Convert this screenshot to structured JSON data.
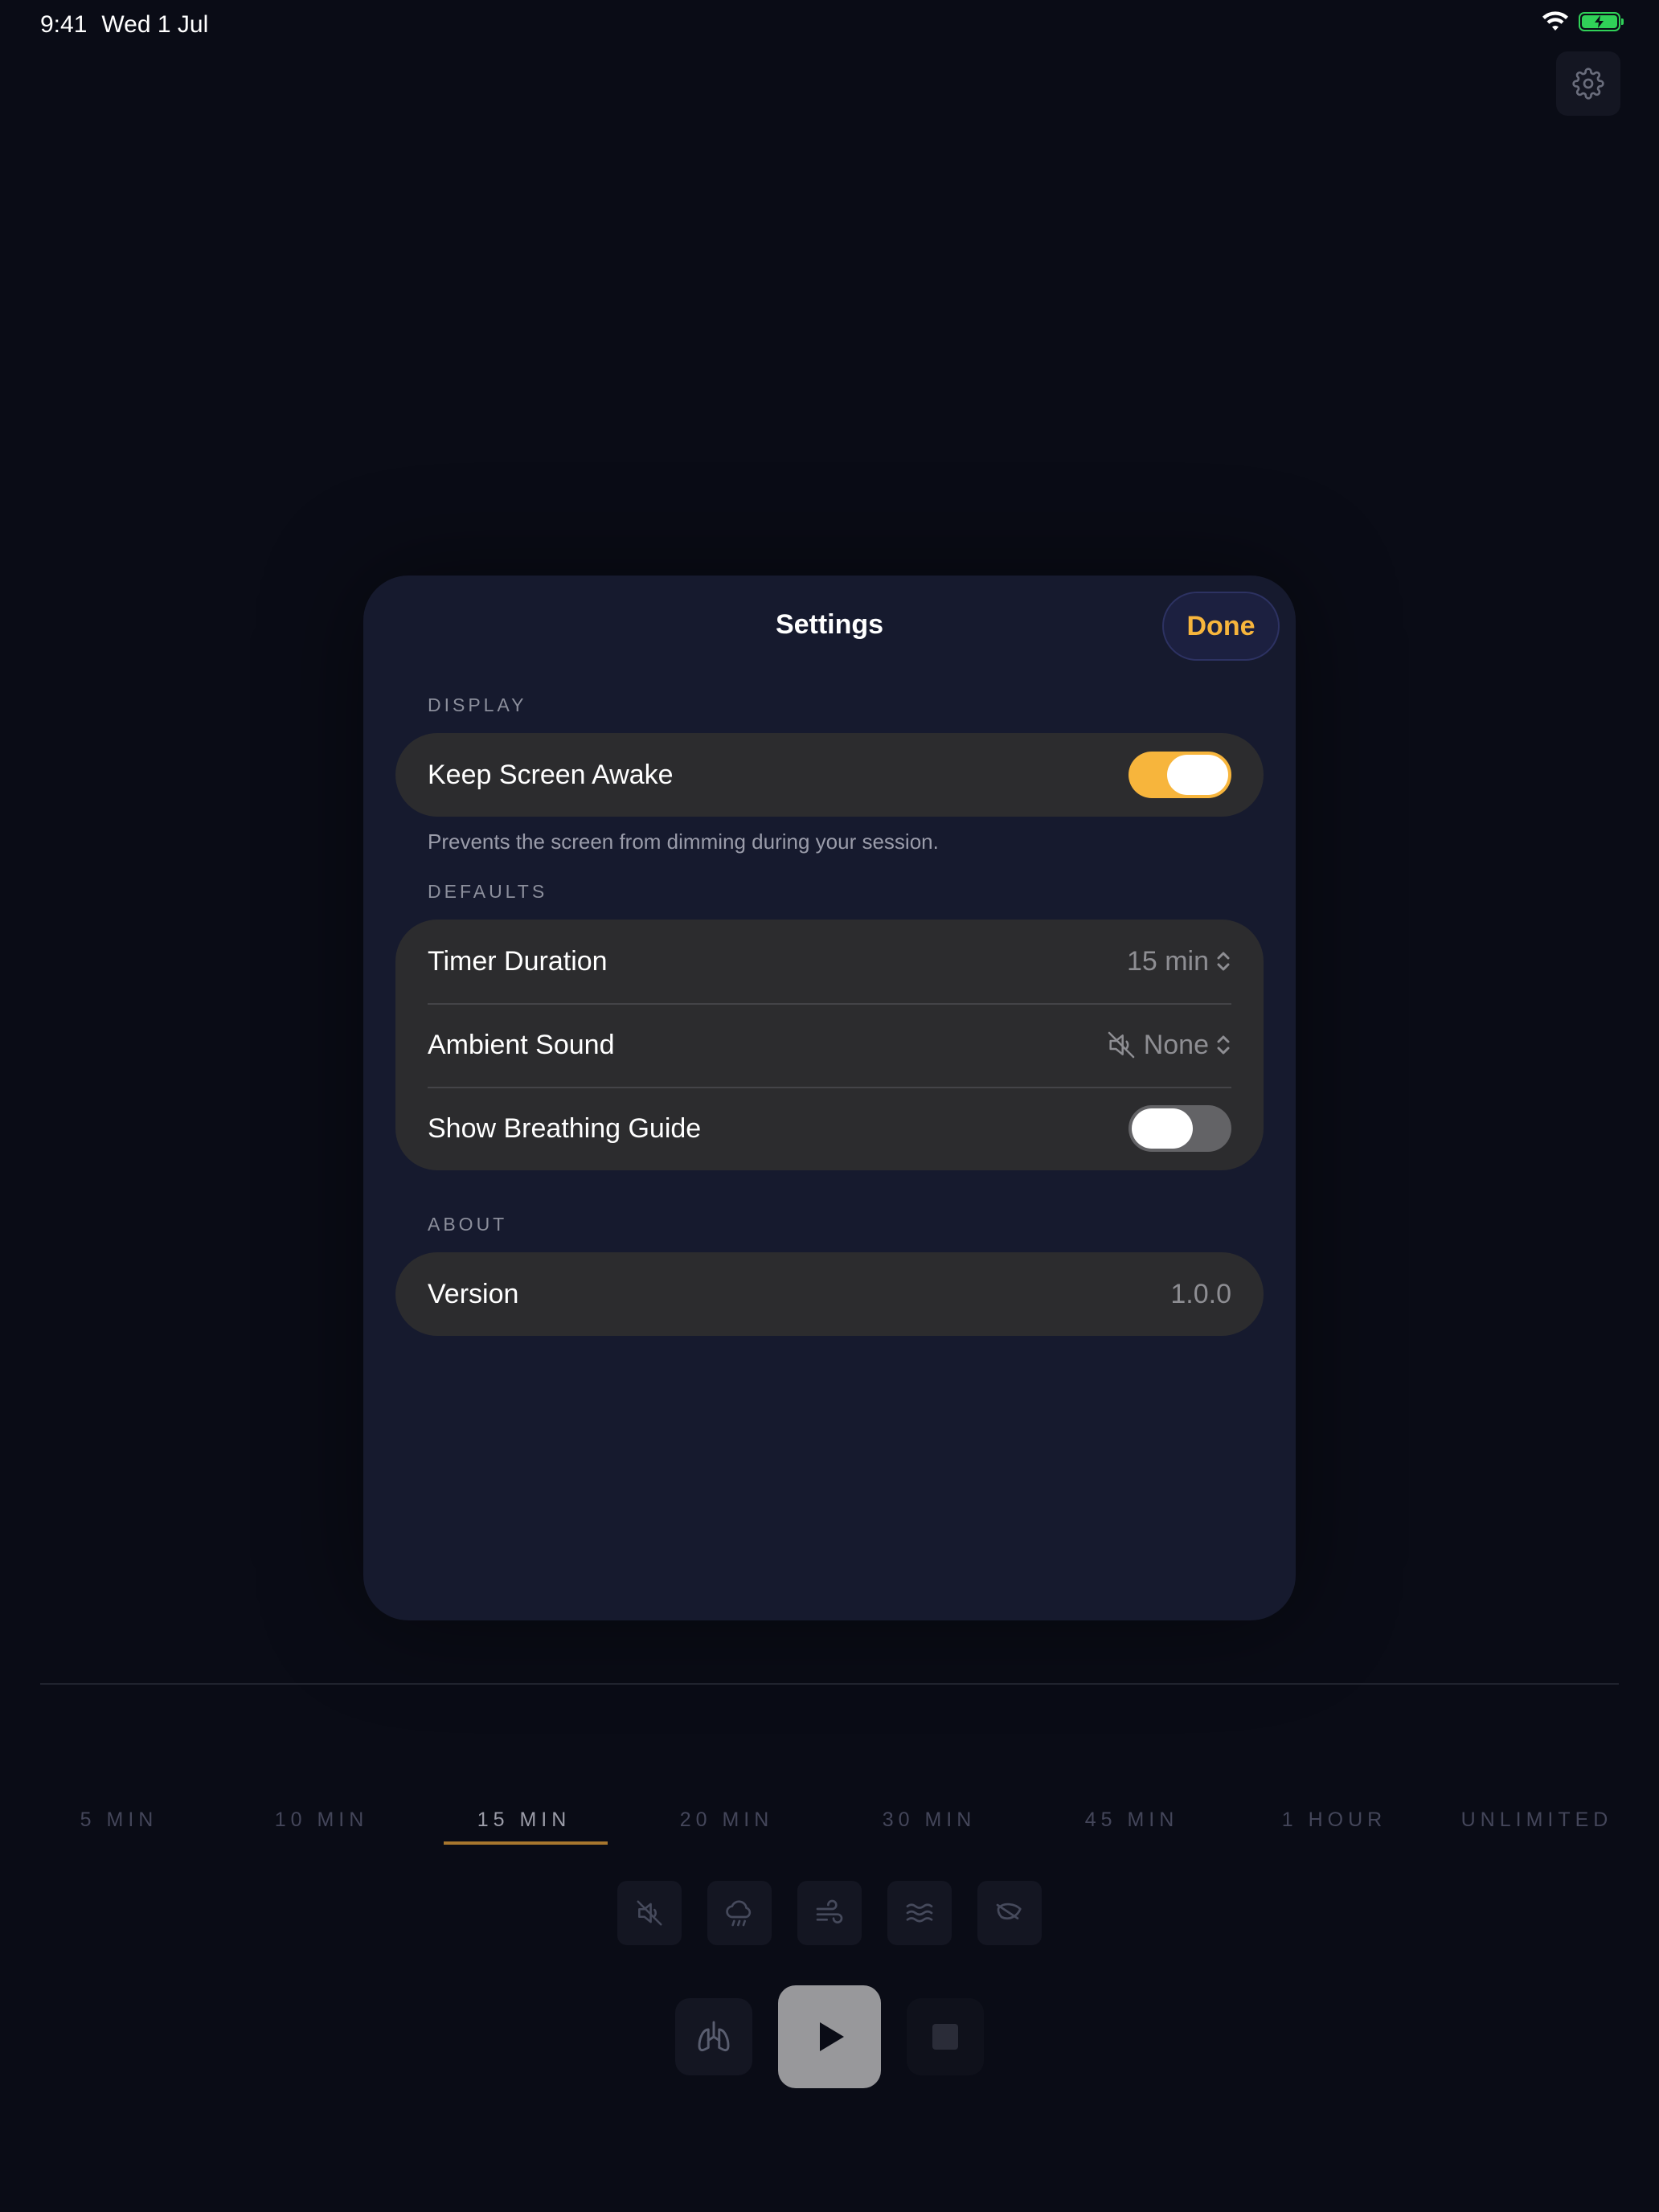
{
  "status_bar": {
    "time": "9:41",
    "date": "Wed 1 Jul"
  },
  "settings": {
    "title": "Settings",
    "done_label": "Done",
    "display": {
      "header": "DISPLAY",
      "keep_screen_awake": {
        "label": "Keep Screen Awake",
        "on": true
      },
      "footnote": "Prevents the screen from dimming during your session."
    },
    "defaults": {
      "header": "DEFAULTS",
      "timer_duration": {
        "label": "Timer Duration",
        "value": "15 min"
      },
      "ambient_sound": {
        "label": "Ambient Sound",
        "value": "None"
      },
      "breathing_guide": {
        "label": "Show Breathing Guide",
        "on": false
      }
    },
    "about": {
      "header": "ABOUT",
      "version": {
        "label": "Version",
        "value": "1.0.0"
      }
    }
  },
  "durations": [
    "5 MIN",
    "10 MIN",
    "15 MIN",
    "20 MIN",
    "30 MIN",
    "45 MIN",
    "1 HOUR",
    "UNLIMITED"
  ],
  "selected_duration": "15 MIN",
  "sounds": [
    "speaker-mute-icon",
    "rain-cloud-icon",
    "wind-icon",
    "waves-icon",
    "leaf-icon"
  ],
  "colors": {
    "accent": "#f7b53c",
    "background": "#0a0c16",
    "sheet": "#161a2e",
    "cell": "#2c2c2e",
    "battery": "#30d158"
  }
}
